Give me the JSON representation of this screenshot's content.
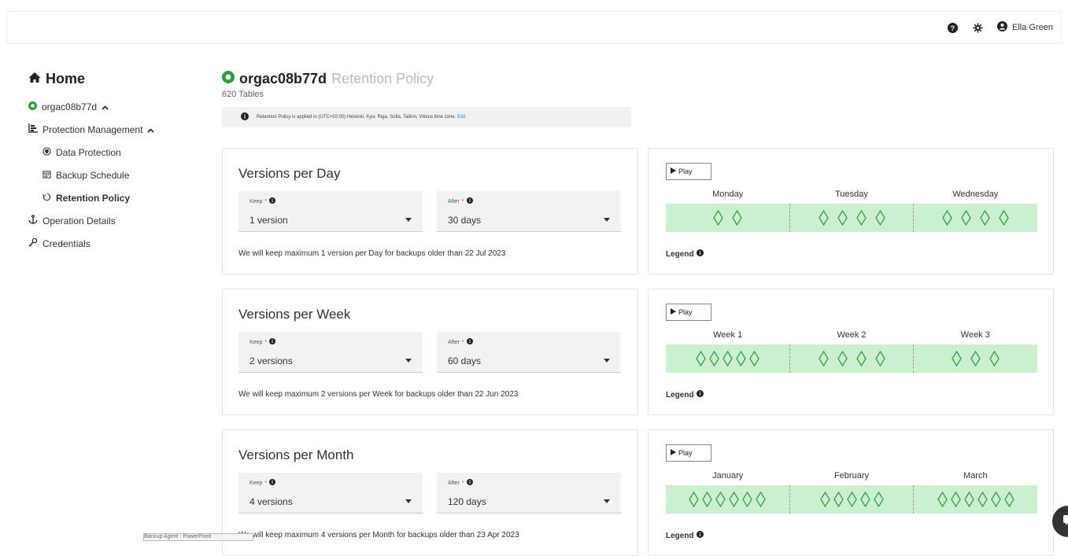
{
  "header": {
    "help_icon": "question-circle-icon",
    "settings_icon": "gear-icon",
    "user_name": "Ella Green"
  },
  "sidebar": {
    "home": "Home",
    "org": "orgac08b77d",
    "protection": "Protection Management",
    "items": [
      {
        "label": "Data Protection",
        "icon": "shield-icon"
      },
      {
        "label": "Backup Schedule",
        "icon": "calendar-icon"
      },
      {
        "label": "Retention Policy",
        "icon": "retention-icon"
      }
    ],
    "operation": "Operation Details",
    "credentials": "Credentials"
  },
  "main": {
    "org_title": "orgac08b77d",
    "page_title": "Retention Policy",
    "tables_count": "620 Tables",
    "info_text": "Retention Policy is applied in (UTC+02:00) Helsinki, Kyiv, Riga, Sofia, Tallinn, Vilnius time zone.",
    "info_edit": "Edit"
  },
  "sections": [
    {
      "title": "Versions per Day",
      "keep_label": "Keep",
      "keep_value": "1 version",
      "after_label": "After",
      "after_value": "30 days",
      "message": "We will keep maximum 1 version per Day for backups older than 22 Jul 2023",
      "play": "Play",
      "periods": [
        "Monday",
        "Tuesday",
        "Wednesday"
      ],
      "diamonds": [
        2,
        4,
        4
      ],
      "legend": "Legend"
    },
    {
      "title": "Versions per Week",
      "keep_label": "Keep",
      "keep_value": "2 versions",
      "after_label": "After",
      "after_value": "60 days",
      "message": "We will keep maximum 2 versions per Week for backups older than 22 Jun 2023",
      "play": "Play",
      "periods": [
        "Week 1",
        "Week 2",
        "Week 3"
      ],
      "diamonds": [
        5,
        4,
        3
      ],
      "legend": "Legend"
    },
    {
      "title": "Versions per Month",
      "keep_label": "Keep",
      "keep_value": "4 versions",
      "after_label": "After",
      "after_value": "120 days",
      "message": "We will keep maximum 4 versions per Month for backups older than 23 Apr 2023",
      "play": "Play",
      "periods": [
        "January",
        "February",
        "March"
      ],
      "diamonds": [
        6,
        5,
        6
      ],
      "legend": "Legend"
    }
  ],
  "taskbar": "Backup Agent - PowerPoint",
  "colors": {
    "accent_green": "#2e9e3e",
    "band_green": "#ccefcf",
    "diamond_stroke": "#2da345",
    "link_blue": "#1e88e5"
  }
}
